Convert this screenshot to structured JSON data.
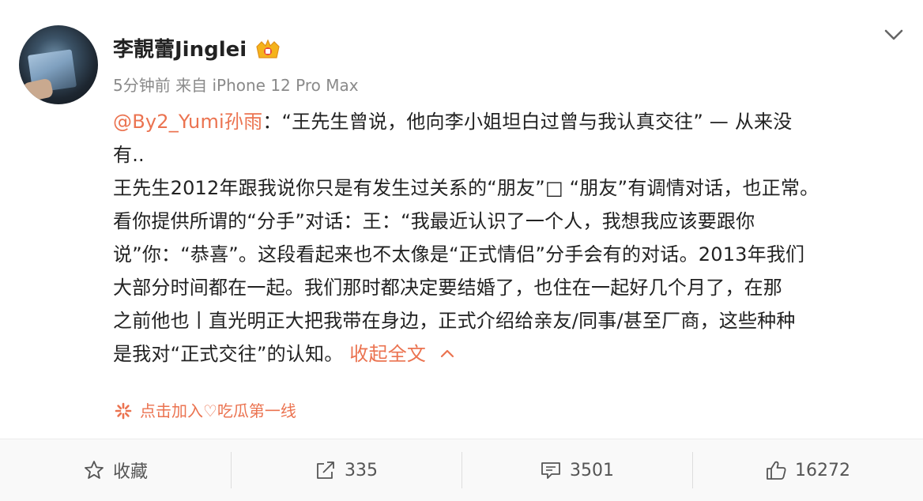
{
  "post": {
    "author": "李靚蕾Jinglei",
    "time": "5分钟前",
    "source_prefix": "来自",
    "source": "iPhone 12 Pro Max",
    "mention": "@By2_Yumi孙雨",
    "lines": [
      "：“王先生曾说，他向李小姐坦白过曾与我认真交往” — 从来没",
      "有..",
      "王先生2012年跟我说你只是有发生过关系的“朋友”□ “朋友”有调情对话，也正常。",
      "看你提供所谓的“分手”对话：王：“我最近认识了一个人，我想我应该要跟你",
      "说”你：“恭喜”。这段看起来也不太像是“正式情侣”分手会有的对话。2013年我们",
      "大部分时间都在一起。我们那时都决定要结婚了，也住在一起好几个月了，在那",
      "之前他也丨直光明正大把我带在身边，正式介绍给亲友/同事/甚至厂商，这些种种",
      "是我对“正式交往”的认知。 "
    ],
    "collapse_label": "收起全文",
    "supertopic": "点击加入♡吃瓜第一线"
  },
  "actions": {
    "favorite": "收藏",
    "repost": "335",
    "comment": "3501",
    "like": "16272"
  },
  "colors": {
    "accent": "#eb7350",
    "text": "#222222",
    "meta": "#8a8a8a"
  },
  "icons": [
    "chevron-down-icon",
    "vip-crown-icon",
    "chevron-up-icon",
    "supertopic-icon",
    "star-icon",
    "repost-icon",
    "comment-icon",
    "thumbs-up-icon"
  ]
}
